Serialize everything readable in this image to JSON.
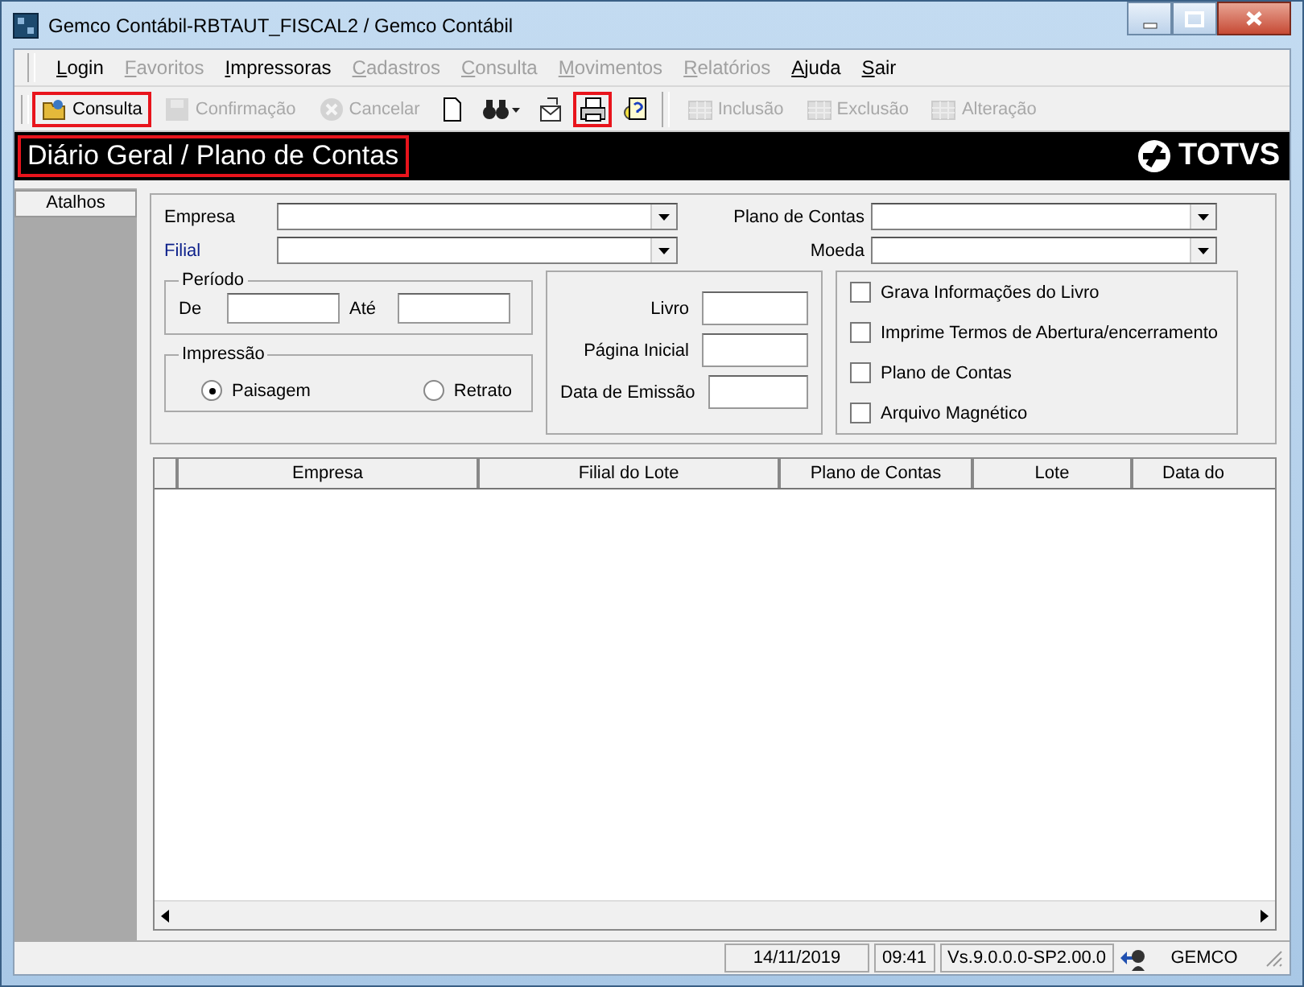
{
  "window": {
    "title": "Gemco Contábil-RBTAUT_FISCAL2 / Gemco Contábil"
  },
  "menu": [
    {
      "label": "Login",
      "disabled": false
    },
    {
      "label": "Favoritos",
      "disabled": true
    },
    {
      "label": "Impressoras",
      "disabled": false
    },
    {
      "label": "Cadastros",
      "disabled": true
    },
    {
      "label": "Consulta",
      "disabled": true
    },
    {
      "label": "Movimentos",
      "disabled": true
    },
    {
      "label": "Relatórios",
      "disabled": true
    },
    {
      "label": "Ajuda",
      "disabled": false
    },
    {
      "label": "Sair",
      "disabled": false
    }
  ],
  "toolbar": [
    {
      "kind": "text",
      "label": "Consulta",
      "disabled": false,
      "highlighted": true
    },
    {
      "kind": "text",
      "label": "Confirmação",
      "disabled": true,
      "highlighted": false
    },
    {
      "kind": "text",
      "label": "Cancelar",
      "disabled": true,
      "highlighted": false
    },
    {
      "kind": "icon",
      "disabled": false,
      "highlighted": false
    },
    {
      "kind": "icon",
      "disabled": false,
      "highlighted": false
    },
    {
      "kind": "icon",
      "disabled": false,
      "highlighted": false
    },
    {
      "kind": "icon",
      "disabled": false,
      "highlighted": true
    },
    {
      "kind": "icon",
      "disabled": false,
      "highlighted": false
    },
    {
      "kind": "separator"
    },
    {
      "kind": "text",
      "label": "Inclusão",
      "disabled": true,
      "highlighted": false
    },
    {
      "kind": "text",
      "label": "Exclusão",
      "disabled": true,
      "highlighted": false
    },
    {
      "kind": "text",
      "label": "Alteração",
      "disabled": true,
      "highlighted": false
    }
  ],
  "header": {
    "title": "Diário Geral / Plano de Contas",
    "highlighted": true,
    "logo": "TOTVS"
  },
  "sidebar": {
    "tab": "Atalhos"
  },
  "filters": {
    "empresa": "Empresa",
    "filial": "Filial",
    "plano": "Plano de Contas",
    "moeda": "Moeda"
  },
  "periodo": {
    "legend": "Período",
    "from": "De",
    "to": "Até"
  },
  "impressao": {
    "legend": "Impressão",
    "options": [
      {
        "label": "Paisagem",
        "selected": true
      },
      {
        "label": "Retrato",
        "selected": false
      }
    ]
  },
  "livro": [
    {
      "label": "Livro"
    },
    {
      "label": "Página Inicial"
    },
    {
      "label": "Data de Emissão"
    }
  ],
  "options": [
    {
      "label": "Grava Informações do Livro",
      "checked": false
    },
    {
      "label": "Imprime Termos de Abertura/encerramento",
      "checked": false
    },
    {
      "label": "Plano de Contas",
      "checked": false
    },
    {
      "label": "Arquivo Magnético",
      "checked": false
    }
  ],
  "table": {
    "columns": [
      "Empresa",
      "Filial do Lote",
      "Plano de Contas",
      "Lote",
      "Data do"
    ]
  },
  "status_bar": {
    "date": "14/11/2019",
    "time": "09:41",
    "version": "Vs.9.0.0.0-SP2.00.0",
    "user": "GEMCO"
  }
}
